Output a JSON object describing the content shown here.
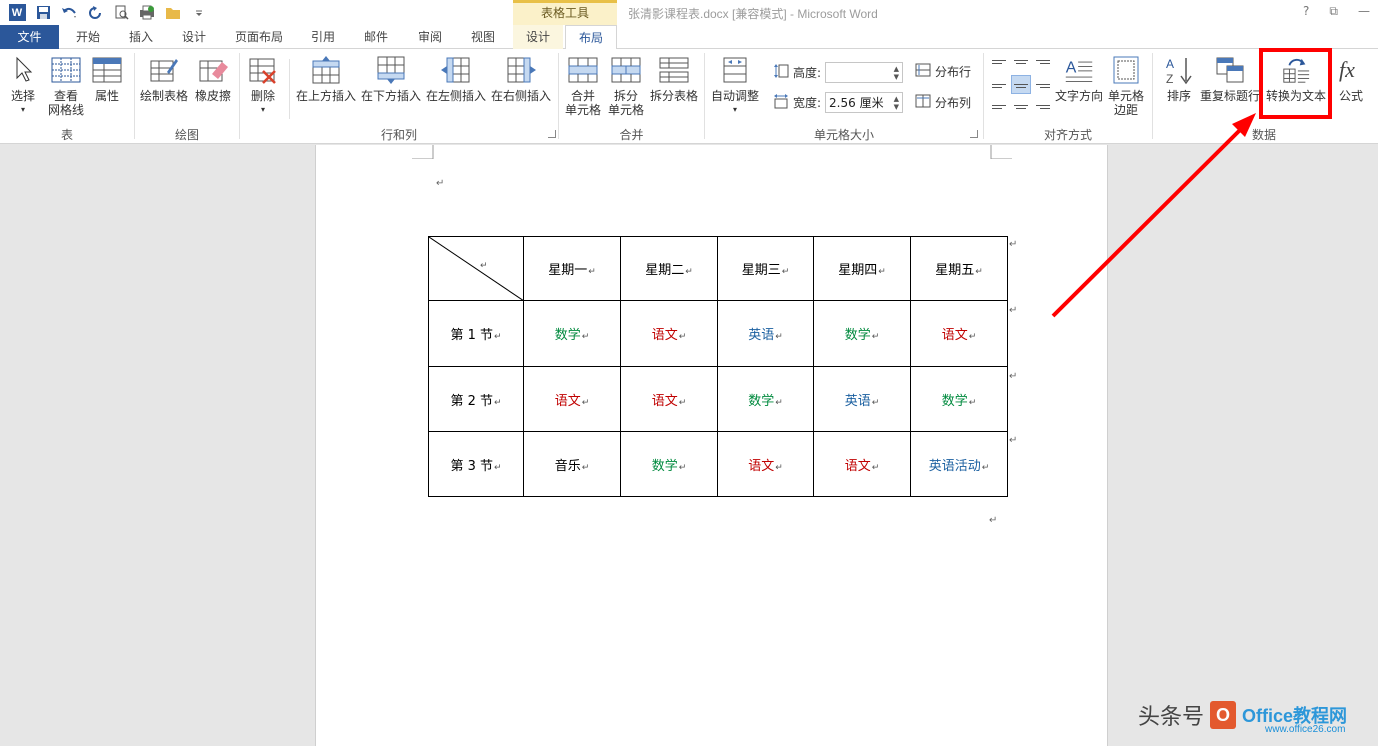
{
  "titlebar": {
    "app_logo": "W",
    "contextual_group": "表格工具",
    "title": "张清影课程表.docx [兼容模式] - Microsoft Word",
    "help": "?",
    "restore": "⧉",
    "minimize": "—"
  },
  "tabs": {
    "file": "文件",
    "home": "开始",
    "insert": "插入",
    "design": "设计",
    "page_layout": "页面布局",
    "references": "引用",
    "mailings": "邮件",
    "review": "审阅",
    "view": "视图",
    "table_design": "设计",
    "table_layout": "布局"
  },
  "ribbon": {
    "table_group": {
      "label": "表",
      "select": "选择",
      "view_gridlines_1": "查看",
      "view_gridlines_2": "网格线",
      "properties": "属性"
    },
    "draw_group": {
      "label": "绘图",
      "draw_table": "绘制表格",
      "eraser": "橡皮擦"
    },
    "rows_cols_group": {
      "label": "行和列",
      "delete": "删除",
      "insert_above": "在上方插入",
      "insert_below": "在下方插入",
      "insert_left": "在左侧插入",
      "insert_right": "在右侧插入"
    },
    "merge_group": {
      "label": "合并",
      "merge_1": "合并",
      "merge_2": "单元格",
      "split_1": "拆分",
      "split_2": "单元格",
      "split_table": "拆分表格"
    },
    "cell_size_group": {
      "label": "单元格大小",
      "autofit": "自动调整",
      "height_label": "高度:",
      "height_value": "",
      "width_label": "宽度:",
      "width_value": "2.56 厘米",
      "distribute_rows": "分布行",
      "distribute_cols": "分布列"
    },
    "alignment_group": {
      "label": "对齐方式",
      "text_direction": "文字方向",
      "cell_margins_1": "单元格",
      "cell_margins_2": "边距"
    },
    "data_group": {
      "label": "数据",
      "sort": "排序",
      "repeat_header": "重复标题行",
      "convert_to_text": "转换为文本",
      "formula": "公式"
    }
  },
  "document": {
    "table": {
      "header": [
        "星期一",
        "星期二",
        "星期三",
        "星期四",
        "星期五"
      ],
      "rows": [
        {
          "label": "第 1 节",
          "cells": [
            {
              "text": "数学",
              "color": "#008a3e"
            },
            {
              "text": "语文",
              "color": "#c00000"
            },
            {
              "text": "英语",
              "color": "#1a5fa0"
            },
            {
              "text": "数学",
              "color": "#008a3e"
            },
            {
              "text": "语文",
              "color": "#c00000"
            }
          ]
        },
        {
          "label": "第 2 节",
          "cells": [
            {
              "text": "语文",
              "color": "#c00000"
            },
            {
              "text": "语文",
              "color": "#c00000"
            },
            {
              "text": "数学",
              "color": "#008a3e"
            },
            {
              "text": "英语",
              "color": "#1a5fa0"
            },
            {
              "text": "数学",
              "color": "#008a3e"
            }
          ]
        },
        {
          "label": "第 3 节",
          "cells": [
            {
              "text": "音乐",
              "color": "#000000"
            },
            {
              "text": "数学",
              "color": "#008a3e"
            },
            {
              "text": "语文",
              "color": "#c00000"
            },
            {
              "text": "语文",
              "color": "#c00000"
            },
            {
              "text": "英语活动",
              "color": "#1a5fa0"
            }
          ]
        }
      ]
    },
    "paragraph_mark": "↵"
  },
  "watermark": {
    "text": "头条号",
    "logo": "O",
    "brand": "Office教程网",
    "url": "www.office26.com"
  },
  "colors": {
    "accent": "#2b579a",
    "highlight": "#ff0000"
  }
}
